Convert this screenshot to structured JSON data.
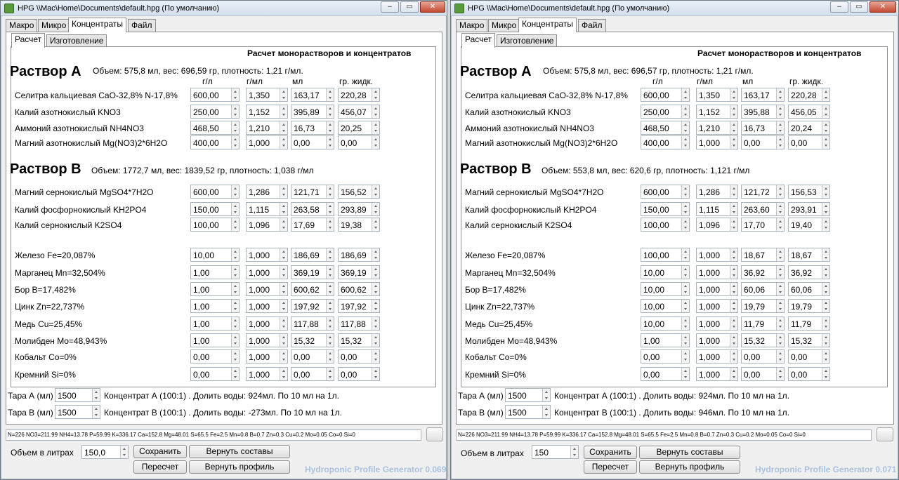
{
  "windows": [
    {
      "title": "HPG \\\\Mac\\Home\\Documents\\default.hpg (По умолчанию)",
      "tabs": [
        "Макро",
        "Микро",
        "Концентраты",
        "Файл"
      ],
      "subtabs": [
        "Расчет",
        "Изготовление"
      ],
      "section_title": "Расчет монорастворов и концентратов",
      "columns": [
        "г/л",
        "г/мл",
        "мл",
        "гр. жидк."
      ],
      "solution_a": {
        "title": "Раствор А",
        "info": "Объем: 575,8 мл, вес: 696,59 гр, плотность: 1,21 г/мл.",
        "rows": [
          {
            "label": "Селитра кальциевая CaO-32,8% N-17,8%",
            "values": [
              "600,00",
              "1,350",
              "163,17",
              "220,28"
            ]
          },
          {
            "label": "Калий азотнокислый KNO3",
            "values": [
              "250,00",
              "1,152",
              "395,89",
              "456,07"
            ]
          },
          {
            "label": "Аммоний азотнокислый NH4NO3",
            "values": [
              "468,50",
              "1,210",
              "16,73",
              "20,25"
            ]
          },
          {
            "label": "Магний азотнокислый Mg(NO3)2*6H2O",
            "values": [
              "400,00",
              "1,000",
              "0,00",
              "0,00"
            ]
          }
        ]
      },
      "solution_b": {
        "title": "Раствор В",
        "info": "Объем: 1772,7 мл, вес: 1839,52 гр, плотность: 1,038 г/мл",
        "rows": [
          {
            "label": "Магний сернокислый MgSO4*7H2O",
            "values": [
              "600,00",
              "1,286",
              "121,71",
              "156,52"
            ]
          },
          {
            "label": "Калий фосфорнокислый KH2PO4",
            "values": [
              "150,00",
              "1,115",
              "263,58",
              "293,89"
            ]
          },
          {
            "label": "Калий сернокислый K2SO4",
            "values": [
              "100,00",
              "1,096",
              "17,69",
              "19,38"
            ]
          }
        ]
      },
      "micro_rows": [
        {
          "label": "Железо Fe=20,087%",
          "values": [
            "10,00",
            "1,000",
            "186,69",
            "186,69"
          ]
        },
        {
          "label": "Марганец Mn=32,504%",
          "values": [
            "1,00",
            "1,000",
            "369,19",
            "369,19"
          ]
        },
        {
          "label": "Бор B=17,482%",
          "values": [
            "1,00",
            "1,000",
            "600,62",
            "600,62"
          ]
        },
        {
          "label": "Цинк Zn=22,737%",
          "values": [
            "1,00",
            "1,000",
            "197,92",
            "197,92"
          ]
        },
        {
          "label": "Медь Cu=25,45%",
          "values": [
            "1,00",
            "1,000",
            "117,88",
            "117,88"
          ]
        },
        {
          "label": "Молибден Mo=48,943%",
          "values": [
            "1,00",
            "1,000",
            "15,32",
            "15,32"
          ]
        },
        {
          "label": "Кобальт Co=0%",
          "values": [
            "0,00",
            "1,000",
            "0,00",
            "0,00"
          ]
        },
        {
          "label": "Кремний Si=0%",
          "values": [
            "0,00",
            "1,000",
            "0,00",
            "0,00"
          ]
        }
      ],
      "tara": [
        {
          "label": "Тара А (мл)",
          "value": "1500",
          "text": "Концентрат А (100:1) . Долить воды: 924мл. По 10 мл на 1л."
        },
        {
          "label": "Тара В (мл)",
          "value": "1500",
          "text": "Концентрат В (100:1) . Долить воды: -273мл. По 10 мл на 1л."
        }
      ],
      "status": "N=226 NO3=211.99 NH4=13.78 P=59.99 K=336.17 Ca=152.8 Mg=48.01 S=65.5 Fe=2.5 Mn=0.8 B=0.7 Zn=0.3 Cu=0.2 Mo=0.05 Co=0 Si=0",
      "volume_label": "Объем в литрах",
      "volume_value": "150,0",
      "buttons": {
        "save": "Сохранить",
        "restore_compositions": "Вернуть составы",
        "recalc": "Пересчет",
        "restore_profile": "Вернуть профиль"
      },
      "version": "Hydroponic Profile Generator 0.069"
    },
    {
      "title": "HPG \\\\Mac\\Home\\Documents\\default.hpg (По умолчанию)",
      "tabs": [
        "Макро",
        "Микро",
        "Концентраты",
        "Файл"
      ],
      "subtabs": [
        "Расчет",
        "Изготовление"
      ],
      "section_title": "Расчет монорастворов и концентратов",
      "columns": [
        "г/л",
        "г/мл",
        "мл",
        "гр. жидк."
      ],
      "solution_a": {
        "title": "Раствор А",
        "info": "Объем: 575,8 мл, вес: 696,57 гр, плотность: 1,21 г/мл.",
        "rows": [
          {
            "label": "Селитра кальциевая CaO-32,8% N-17,8%",
            "values": [
              "600,00",
              "1,350",
              "163,17",
              "220,28"
            ]
          },
          {
            "label": "Калий азотнокислый KNO3",
            "values": [
              "250,00",
              "1,152",
              "395,88",
              "456,05"
            ]
          },
          {
            "label": "Аммоний азотнокислый NH4NO3",
            "values": [
              "468,50",
              "1,210",
              "16,73",
              "20,24"
            ]
          },
          {
            "label": "Магний азотнокислый Mg(NO3)2*6H2O",
            "values": [
              "400,00",
              "1,000",
              "0,00",
              "0,00"
            ]
          }
        ]
      },
      "solution_b": {
        "title": "Раствор В",
        "info": "Объем: 553,8 мл, вес: 620,6 гр, плотность: 1,121 г/мл",
        "rows": [
          {
            "label": "Магний сернокислый MgSO4*7H2O",
            "values": [
              "600,00",
              "1,286",
              "121,72",
              "156,53"
            ]
          },
          {
            "label": "Калий фосфорнокислый KH2PO4",
            "values": [
              "150,00",
              "1,115",
              "263,60",
              "293,91"
            ]
          },
          {
            "label": "Калий сернокислый K2SO4",
            "values": [
              "100,00",
              "1,096",
              "17,70",
              "19,40"
            ]
          }
        ]
      },
      "micro_rows": [
        {
          "label": "Железо Fe=20,087%",
          "values": [
            "100,00",
            "1,000",
            "18,67",
            "18,67"
          ]
        },
        {
          "label": "Марганец Mn=32,504%",
          "values": [
            "10,00",
            "1,000",
            "36,92",
            "36,92"
          ]
        },
        {
          "label": "Бор B=17,482%",
          "values": [
            "10,00",
            "1,000",
            "60,06",
            "60,06"
          ]
        },
        {
          "label": "Цинк Zn=22,737%",
          "values": [
            "10,00",
            "1,000",
            "19,79",
            "19,79"
          ]
        },
        {
          "label": "Медь Cu=25,45%",
          "values": [
            "10,00",
            "1,000",
            "11,79",
            "11,79"
          ]
        },
        {
          "label": "Молибден Mo=48,943%",
          "values": [
            "1,00",
            "1,000",
            "15,32",
            "15,32"
          ]
        },
        {
          "label": "Кобальт Co=0%",
          "values": [
            "0,00",
            "1,000",
            "0,00",
            "0,00"
          ]
        },
        {
          "label": "Кремний Si=0%",
          "values": [
            "0,00",
            "1,000",
            "0,00",
            "0,00"
          ]
        }
      ],
      "tara": [
        {
          "label": "Тара А (мл)",
          "value": "1500",
          "text": "Концентрат А (100:1) . Долить воды: 924мл. По 10 мл на 1л."
        },
        {
          "label": "Тара В (мл)",
          "value": "1500",
          "text": "Концентрат В (100:1) . Долить воды: 946мл. По 10 мл на 1л."
        }
      ],
      "status": "N=226 NO3=211.99 NH4=13.78 P=59.99 K=336.17 Ca=152.8 Mg=48.01 S=65.5 Fe=2.5 Mn=0.8 B=0.7 Zn=0.3 Cu=0.2 Mo=0.05 Co=0 Si=0",
      "volume_label": "Объем в литрах",
      "volume_value": "150",
      "buttons": {
        "save": "Сохранить",
        "restore_compositions": "Вернуть составы",
        "recalc": "Пересчет",
        "restore_profile": "Вернуть профиль"
      },
      "version": "Hydroponic Profile Generator 0.071"
    }
  ]
}
